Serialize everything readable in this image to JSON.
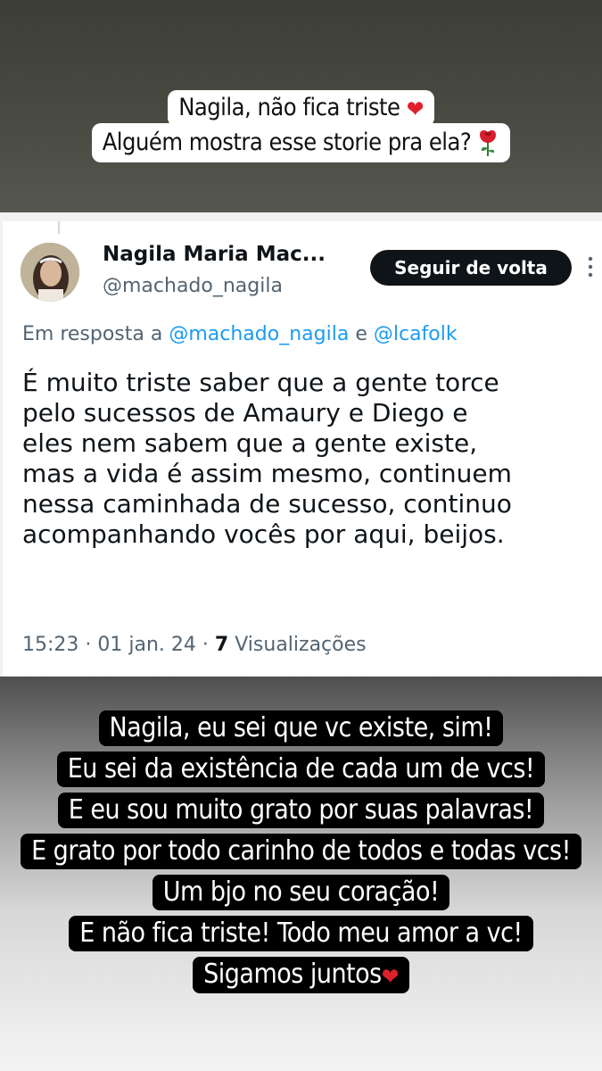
{
  "caption_top": {
    "line1": "Nagila, não fica triste",
    "line2": "Alguém mostra esse storie pra ela?",
    "heart": "❤"
  },
  "tweet": {
    "display_name": "Nagila Maria Mac...",
    "handle": "@machado_nagila",
    "follow_label": "Seguir de volta",
    "reply_prefix": "Em resposta a",
    "reply_mention_1": "@machado_nagila",
    "reply_joiner": "e",
    "reply_mention_2": "@lcafolk",
    "text_lines": [
      "É muito triste saber que a gente torce",
      "pelo sucessos de Amaury e Diego e",
      "eles nem sabem que a gente existe,",
      "mas a vida é assim mesmo, continuem",
      "nessa caminhada de sucesso,  continuo",
      "acompanhando vocês por aqui, beijos."
    ],
    "time": "15:23",
    "date": "01 jan. 24",
    "views_count": "7",
    "views_label": "Visualizações"
  },
  "caption_bottom": {
    "lines": [
      "Nagila, eu sei que vc existe, sim!",
      "Eu sei da existência de cada um de vcs!",
      "E eu sou muito grato por suas palavras!",
      "E grato por todo carinho de todos e todas vcs!",
      "Um bjo no seu coração!",
      "E não fica triste! Todo meu amor a vc!",
      "Sigamos juntos"
    ],
    "heart": "❤"
  },
  "colors": {
    "link": "#1d9bf0",
    "muted": "#536471",
    "text": "#0f1419",
    "heart": "#e0202a"
  },
  "icons": [
    "rose-icon",
    "heart-icon",
    "more-options-icon",
    "avatar"
  ]
}
